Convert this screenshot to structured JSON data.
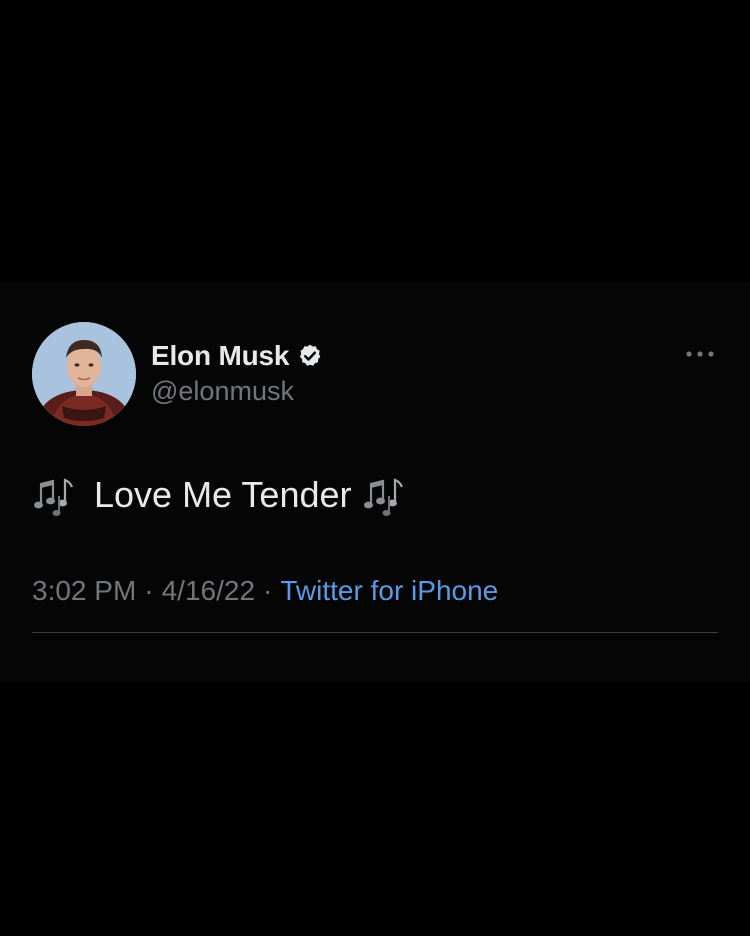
{
  "colors": {
    "background": "#000000",
    "card": "#050505",
    "primary_text": "#e7e9ea",
    "secondary_text": "#71767b",
    "link": "#5b9be6",
    "divider": "#3a3d41"
  },
  "author": {
    "display_name": "Elon Musk",
    "handle": "@elonmusk",
    "verified_icon": "verified-badge-icon",
    "avatar": "profile-photo"
  },
  "tweet": {
    "leading_icon": "musical-notes-icon",
    "text": "Love Me Tender",
    "trailing_icon": "musical-notes-icon"
  },
  "meta": {
    "time": "3:02 PM",
    "separator": "·",
    "date": "4/16/22",
    "source": "Twitter for iPhone"
  },
  "actions": {
    "more_icon": "more-dots-icon"
  }
}
